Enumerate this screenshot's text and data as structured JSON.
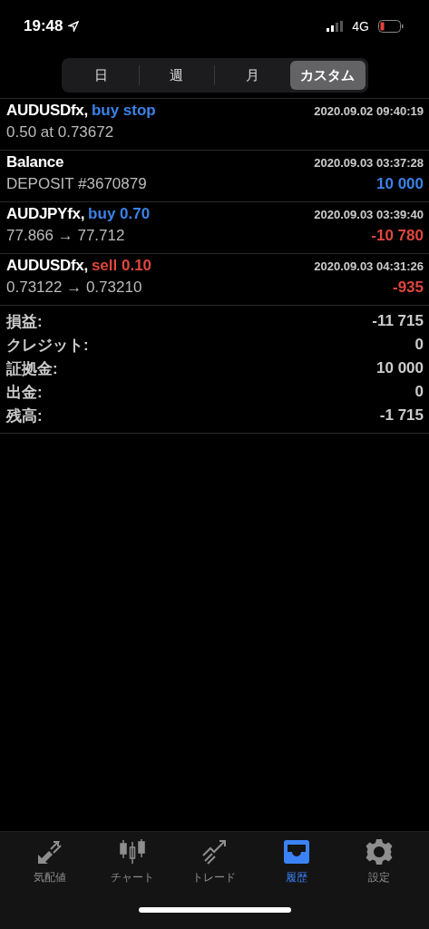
{
  "status_bar": {
    "time": "19:48",
    "network": "4G"
  },
  "period_tabs": [
    {
      "label": "日",
      "selected": false
    },
    {
      "label": "週",
      "selected": false
    },
    {
      "label": "月",
      "selected": false
    },
    {
      "label": "カスタム",
      "selected": true
    }
  ],
  "deals": [
    {
      "symbol": "AUDUSDfx,",
      "action": {
        "text": "buy stop",
        "color": "#3b82e8"
      },
      "time": "2020.09.02 09:40:19",
      "detail": "0.50 at 0.73672"
    },
    {
      "symbol": "Balance",
      "time": "2020.09.03 03:37:28",
      "detail": "DEPOSIT #3670879",
      "profit": {
        "text": "10 000",
        "color": "#3b82e8"
      }
    },
    {
      "symbol": "AUDJPYfx,",
      "action": {
        "text": "buy 0.70",
        "color": "#3b82e8"
      },
      "time": "2020.09.03 03:39:40",
      "detail": "77.866 → 77.712",
      "profit": {
        "text": "-10 780",
        "color": "#e0473c"
      }
    },
    {
      "symbol": "AUDUSDfx,",
      "action": {
        "text": "sell 0.10",
        "color": "#e0473c"
      },
      "time": "2020.09.03 04:31:26",
      "detail": "0.73122 → 0.73210",
      "profit": {
        "text": "-935",
        "color": "#e0473c"
      }
    }
  ],
  "summary": [
    {
      "label": "損益:",
      "value": "-11 715"
    },
    {
      "label": "クレジット:",
      "value": "0"
    },
    {
      "label": "証拠金:",
      "value": "10 000"
    },
    {
      "label": "出金:",
      "value": "0"
    },
    {
      "label": "残高:",
      "value": "-1 715"
    }
  ],
  "tab_bar": [
    {
      "label": "気配値",
      "kind": "quotes",
      "selected": false
    },
    {
      "label": "チャート",
      "kind": "chart",
      "selected": false
    },
    {
      "label": "トレード",
      "kind": "trade",
      "selected": false
    },
    {
      "label": "履歴",
      "kind": "history",
      "selected": true
    },
    {
      "label": "設定",
      "kind": "settings",
      "selected": false
    }
  ]
}
